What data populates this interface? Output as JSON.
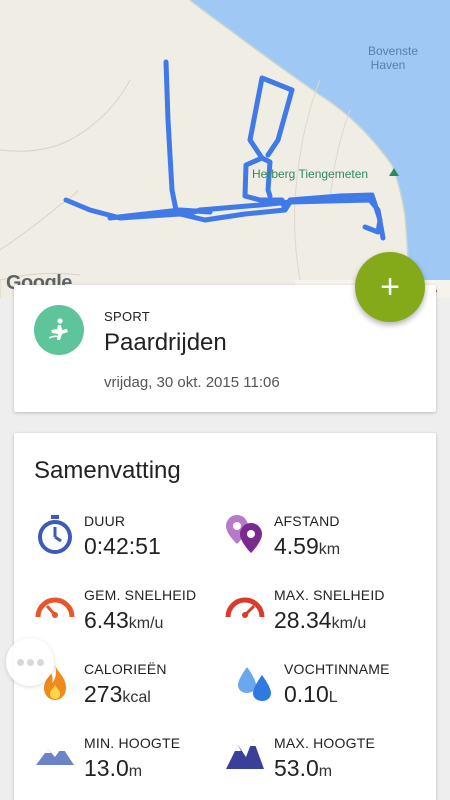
{
  "map": {
    "place_label": "Bovenste\nHaven",
    "poi_label": "Herberg Tiengemeten",
    "logo_text": "Google",
    "edge_text": "le"
  },
  "fab": {
    "icon": "plus-icon"
  },
  "sport": {
    "label": "SPORT",
    "name": "Paardrijden",
    "date": "vrijdag, 30 okt. 2015 11:06",
    "icon": "horse-riding-icon",
    "icon_color": "#5ec49a"
  },
  "summary": {
    "title": "Samenvatting",
    "stats": [
      {
        "label": "DUUR",
        "value": "0:42:51",
        "unit": "",
        "icon": "stopwatch-icon"
      },
      {
        "label": "AFSTAND",
        "value": "4.59",
        "unit": "km",
        "icon": "map-pins-icon"
      },
      {
        "label": "GEM. SNELHEID",
        "value": "6.43",
        "unit": "km/u",
        "icon": "speedometer-icon"
      },
      {
        "label": "MAX. SNELHEID",
        "value": "28.34",
        "unit": "km/u",
        "icon": "speedometer-max-icon"
      },
      {
        "label": "CALORIEËN",
        "value": "273",
        "unit": "kcal",
        "icon": "flame-icon"
      },
      {
        "label": "VOCHTINNAME",
        "value": "0.10",
        "unit": "L",
        "icon": "water-drops-icon"
      },
      {
        "label": "MIN. HOOGTE",
        "value": "13.0",
        "unit": "m",
        "icon": "mountain-min-icon"
      },
      {
        "label": "MAX. HOOGTE",
        "value": "53.0",
        "unit": "m",
        "icon": "mountain-max-icon"
      }
    ]
  },
  "colors": {
    "fab": "#84aa1a",
    "route": "#3f7ae8",
    "water": "#9fc8f5",
    "land": "#f0ede4"
  }
}
